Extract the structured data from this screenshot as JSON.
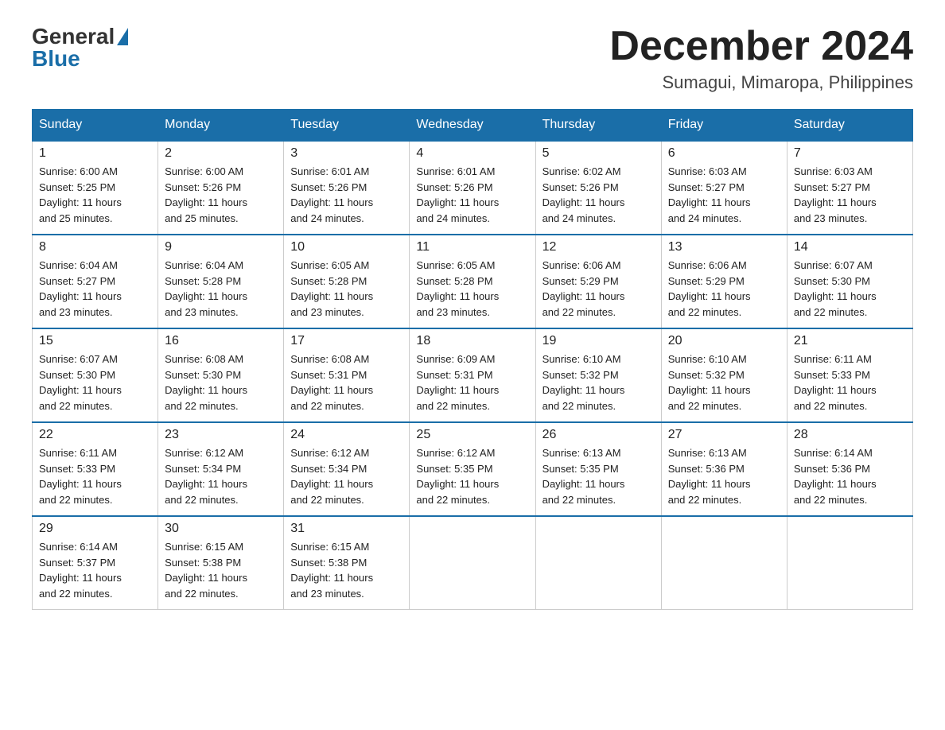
{
  "header": {
    "logo_general": "General",
    "logo_blue": "Blue",
    "month_title": "December 2024",
    "location": "Sumagui, Mimaropa, Philippines"
  },
  "columns": [
    "Sunday",
    "Monday",
    "Tuesday",
    "Wednesday",
    "Thursday",
    "Friday",
    "Saturday"
  ],
  "weeks": [
    [
      {
        "day": "1",
        "info": "Sunrise: 6:00 AM\nSunset: 5:25 PM\nDaylight: 11 hours\nand 25 minutes."
      },
      {
        "day": "2",
        "info": "Sunrise: 6:00 AM\nSunset: 5:26 PM\nDaylight: 11 hours\nand 25 minutes."
      },
      {
        "day": "3",
        "info": "Sunrise: 6:01 AM\nSunset: 5:26 PM\nDaylight: 11 hours\nand 24 minutes."
      },
      {
        "day": "4",
        "info": "Sunrise: 6:01 AM\nSunset: 5:26 PM\nDaylight: 11 hours\nand 24 minutes."
      },
      {
        "day": "5",
        "info": "Sunrise: 6:02 AM\nSunset: 5:26 PM\nDaylight: 11 hours\nand 24 minutes."
      },
      {
        "day": "6",
        "info": "Sunrise: 6:03 AM\nSunset: 5:27 PM\nDaylight: 11 hours\nand 24 minutes."
      },
      {
        "day": "7",
        "info": "Sunrise: 6:03 AM\nSunset: 5:27 PM\nDaylight: 11 hours\nand 23 minutes."
      }
    ],
    [
      {
        "day": "8",
        "info": "Sunrise: 6:04 AM\nSunset: 5:27 PM\nDaylight: 11 hours\nand 23 minutes."
      },
      {
        "day": "9",
        "info": "Sunrise: 6:04 AM\nSunset: 5:28 PM\nDaylight: 11 hours\nand 23 minutes."
      },
      {
        "day": "10",
        "info": "Sunrise: 6:05 AM\nSunset: 5:28 PM\nDaylight: 11 hours\nand 23 minutes."
      },
      {
        "day": "11",
        "info": "Sunrise: 6:05 AM\nSunset: 5:28 PM\nDaylight: 11 hours\nand 23 minutes."
      },
      {
        "day": "12",
        "info": "Sunrise: 6:06 AM\nSunset: 5:29 PM\nDaylight: 11 hours\nand 22 minutes."
      },
      {
        "day": "13",
        "info": "Sunrise: 6:06 AM\nSunset: 5:29 PM\nDaylight: 11 hours\nand 22 minutes."
      },
      {
        "day": "14",
        "info": "Sunrise: 6:07 AM\nSunset: 5:30 PM\nDaylight: 11 hours\nand 22 minutes."
      }
    ],
    [
      {
        "day": "15",
        "info": "Sunrise: 6:07 AM\nSunset: 5:30 PM\nDaylight: 11 hours\nand 22 minutes."
      },
      {
        "day": "16",
        "info": "Sunrise: 6:08 AM\nSunset: 5:30 PM\nDaylight: 11 hours\nand 22 minutes."
      },
      {
        "day": "17",
        "info": "Sunrise: 6:08 AM\nSunset: 5:31 PM\nDaylight: 11 hours\nand 22 minutes."
      },
      {
        "day": "18",
        "info": "Sunrise: 6:09 AM\nSunset: 5:31 PM\nDaylight: 11 hours\nand 22 minutes."
      },
      {
        "day": "19",
        "info": "Sunrise: 6:10 AM\nSunset: 5:32 PM\nDaylight: 11 hours\nand 22 minutes."
      },
      {
        "day": "20",
        "info": "Sunrise: 6:10 AM\nSunset: 5:32 PM\nDaylight: 11 hours\nand 22 minutes."
      },
      {
        "day": "21",
        "info": "Sunrise: 6:11 AM\nSunset: 5:33 PM\nDaylight: 11 hours\nand 22 minutes."
      }
    ],
    [
      {
        "day": "22",
        "info": "Sunrise: 6:11 AM\nSunset: 5:33 PM\nDaylight: 11 hours\nand 22 minutes."
      },
      {
        "day": "23",
        "info": "Sunrise: 6:12 AM\nSunset: 5:34 PM\nDaylight: 11 hours\nand 22 minutes."
      },
      {
        "day": "24",
        "info": "Sunrise: 6:12 AM\nSunset: 5:34 PM\nDaylight: 11 hours\nand 22 minutes."
      },
      {
        "day": "25",
        "info": "Sunrise: 6:12 AM\nSunset: 5:35 PM\nDaylight: 11 hours\nand 22 minutes."
      },
      {
        "day": "26",
        "info": "Sunrise: 6:13 AM\nSunset: 5:35 PM\nDaylight: 11 hours\nand 22 minutes."
      },
      {
        "day": "27",
        "info": "Sunrise: 6:13 AM\nSunset: 5:36 PM\nDaylight: 11 hours\nand 22 minutes."
      },
      {
        "day": "28",
        "info": "Sunrise: 6:14 AM\nSunset: 5:36 PM\nDaylight: 11 hours\nand 22 minutes."
      }
    ],
    [
      {
        "day": "29",
        "info": "Sunrise: 6:14 AM\nSunset: 5:37 PM\nDaylight: 11 hours\nand 22 minutes."
      },
      {
        "day": "30",
        "info": "Sunrise: 6:15 AM\nSunset: 5:38 PM\nDaylight: 11 hours\nand 22 minutes."
      },
      {
        "day": "31",
        "info": "Sunrise: 6:15 AM\nSunset: 5:38 PM\nDaylight: 11 hours\nand 23 minutes."
      },
      null,
      null,
      null,
      null
    ]
  ]
}
